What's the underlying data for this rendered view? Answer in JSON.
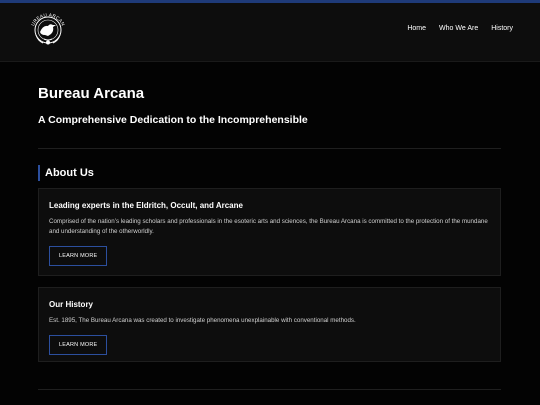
{
  "brand": {
    "name": "Bureau Arcana",
    "logo_text": "BUREAU ARCANA"
  },
  "nav": {
    "items": [
      {
        "label": "Home"
      },
      {
        "label": "Who We Are"
      },
      {
        "label": "History"
      }
    ]
  },
  "hero": {
    "title": "Bureau Arcana",
    "subtitle": "A Comprehensive Dedication to the Incomprehensible"
  },
  "about": {
    "title": "About Us",
    "cards": [
      {
        "title": "Leading experts in the Eldritch, Occult, and Arcane",
        "body": "Comprised of the nation’s leading scholars and professionals in the esoteric arts and sciences, the Bureau Arcana is committed to the protection of the mundane and understanding of the otherworldly.",
        "button": "LEARN MORE"
      },
      {
        "title": "Our History",
        "body": "Est. 1895, The Bureau Arcana was created to investigate phenomena unexplainable with conventional methods.",
        "button": "LEARN MORE"
      }
    ]
  },
  "colors": {
    "background": "#030303",
    "header": "#0d0d0d",
    "accent": "#2c4f9e",
    "card": "#0d0d0d"
  }
}
